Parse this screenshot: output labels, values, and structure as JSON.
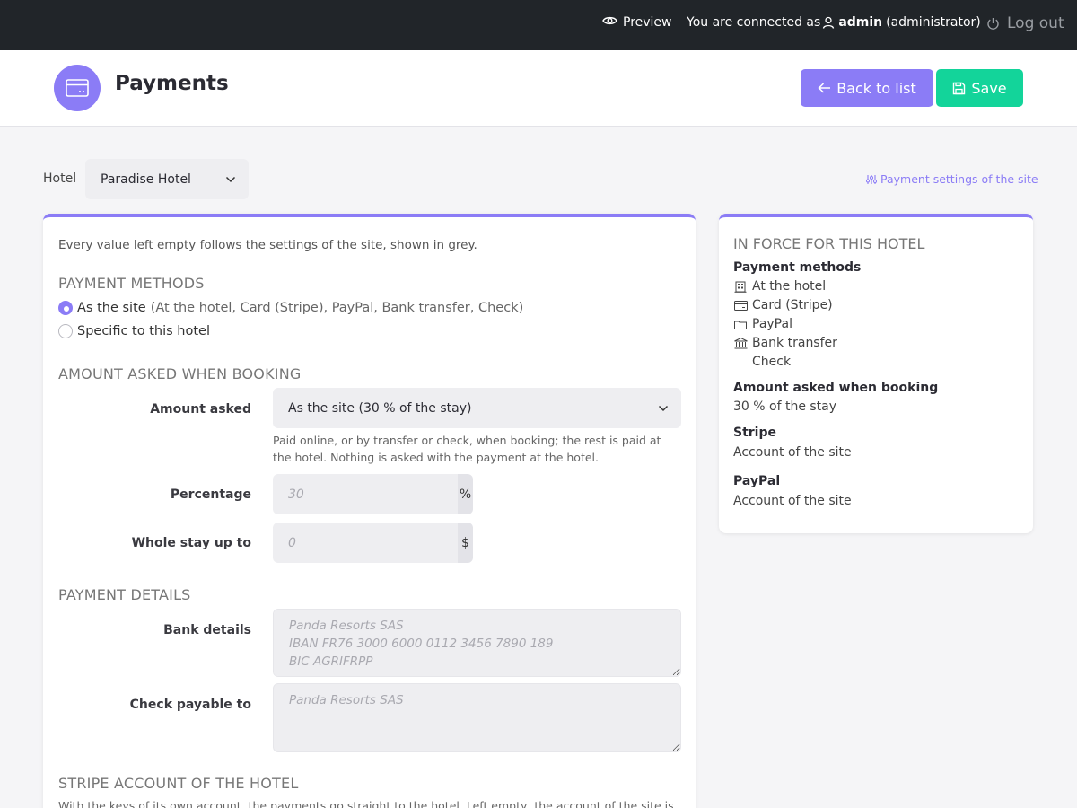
{
  "topbar": {
    "preview_label": "Preview",
    "connected_prefix": "You are connected as",
    "user_name": "admin",
    "user_role": "(administrator)",
    "logout_label": "Log out"
  },
  "header": {
    "title": "Payments",
    "back_label": "Back to list",
    "save_label": "Save"
  },
  "hotel": {
    "label": "Hotel",
    "selected": "Paradise Hotel",
    "site_settings_link": "Payment settings of the site"
  },
  "main": {
    "intro": "Every value left empty follows the settings of the site, shown in grey.",
    "payment_methods": {
      "title": "PAYMENT METHODS",
      "option_site": "As the site",
      "option_site_hint": "(At the hotel, Card (Stripe), PayPal, Bank transfer, Check)",
      "option_specific": "Specific to this hotel"
    },
    "amount": {
      "title": "AMOUNT ASKED WHEN BOOKING",
      "amount_label": "Amount asked",
      "amount_selected": "As the site (30 % of the stay)",
      "help": "Paid online, or by transfer or check, when booking; the rest is paid at the hotel. Nothing is asked with the payment at the hotel.",
      "percentage_label": "Percentage",
      "percentage_placeholder": "30",
      "percentage_unit": "%",
      "whole_stay_label": "Whole stay up to",
      "whole_stay_placeholder": "0",
      "whole_stay_unit": "$"
    },
    "details": {
      "title": "PAYMENT DETAILS",
      "bank_label": "Bank details",
      "bank_placeholder": "Panda Resorts SAS\nIBAN FR76 3000 6000 0112 3456 7890 189\nBIC AGRIFRPP",
      "check_label": "Check payable to",
      "check_placeholder": "Panda Resorts SAS"
    },
    "stripe": {
      "title": "STRIPE ACCOUNT OF THE HOTEL",
      "help": "With the keys of its own account, the payments go straight to the hotel. Left empty, the account of the site is"
    }
  },
  "side": {
    "title": "IN FORCE FOR THIS HOTEL",
    "methods_heading": "Payment methods",
    "methods": [
      {
        "icon": "building-icon",
        "label": "At the hotel"
      },
      {
        "icon": "card-icon",
        "label": "Card (Stripe)"
      },
      {
        "icon": "wallet-icon",
        "label": "PayPal"
      },
      {
        "icon": "bank-icon",
        "label": "Bank transfer"
      },
      {
        "icon": "",
        "label": "Check"
      }
    ],
    "amount_heading": "Amount asked when booking",
    "amount_value": "30 % of the stay",
    "stripe_heading": "Stripe",
    "stripe_value": "Account of the site",
    "paypal_heading": "PayPal",
    "paypal_value": "Account of the site"
  },
  "colors": {
    "accent": "#8b7cf6",
    "save": "#13d49a",
    "topbar": "#212529"
  }
}
